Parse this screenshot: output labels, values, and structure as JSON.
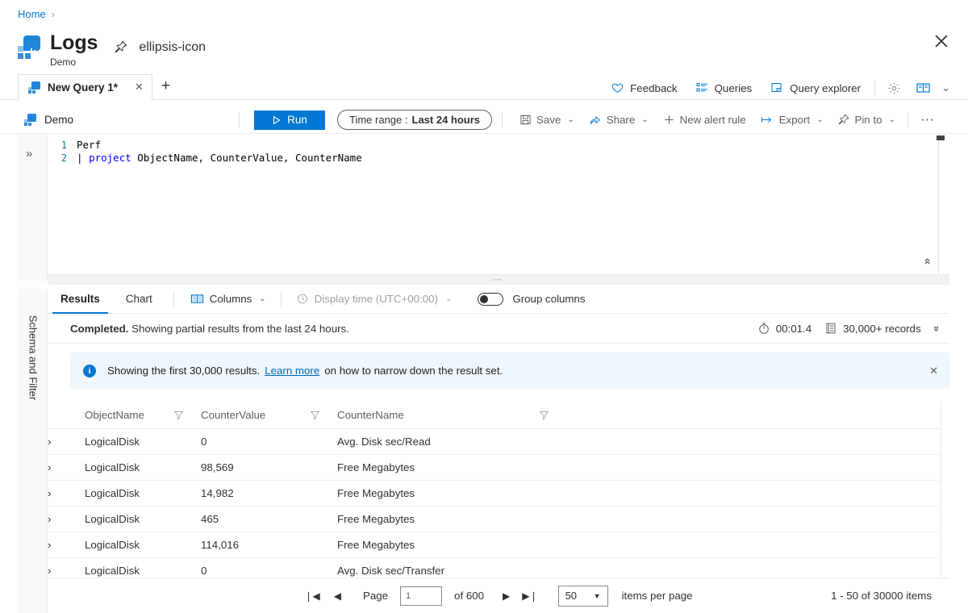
{
  "breadcrumb": {
    "home": "Home",
    "separator": "›"
  },
  "header": {
    "title": "Logs",
    "subtitle": "Demo",
    "pin_icon": "pin-icon",
    "more_icon": "ellipsis-icon",
    "close_icon": "close-icon"
  },
  "tabs": {
    "query_tab_label": "New Query 1*",
    "close_label": "✕",
    "add_label": "+"
  },
  "top_toolbar": {
    "feedback": "Feedback",
    "queries": "Queries",
    "query_explorer": "Query explorer",
    "settings_icon": "gear-icon",
    "guide_icon": "book-icon",
    "guide_chevron": "⌄"
  },
  "command_bar": {
    "workspace": "Demo",
    "run": "Run",
    "time_range_label": "Time range :",
    "time_range_value": "Last 24 hours",
    "save": "Save",
    "share": "Share",
    "new_alert_rule": "New alert rule",
    "export": "Export",
    "pin_to": "Pin to",
    "more": "⋯",
    "chevron": "⌄"
  },
  "rail": {
    "expand_icon": "»",
    "label": "Schema and Filter"
  },
  "editor": {
    "lines": [
      "1",
      "2"
    ],
    "line1": "Perf",
    "line2_pipe": "| ",
    "line2_keyword": "project",
    "line2_rest": " ObjectName, CounterValue, CounterName",
    "collapse_icon": "«"
  },
  "results": {
    "tab_results": "Results",
    "tab_chart": "Chart",
    "columns": "Columns",
    "display_time": "Display time (UTC+00:00)",
    "group_columns": "Group columns",
    "status_bold": "Completed.",
    "status_rest": " Showing partial results from the last 24 hours.",
    "duration": "00:01.4",
    "record_count": "30,000+ records",
    "expand_icon": "»"
  },
  "banner": {
    "text_before": "Showing the first 30,000 results.",
    "link": "Learn more",
    "text_after": "on how to narrow down the result set.",
    "close": "✕"
  },
  "table": {
    "columns": [
      "ObjectName",
      "CounterValue",
      "CounterName"
    ],
    "rows": [
      {
        "expand": "›",
        "ObjectName": "LogicalDisk",
        "CounterValue": "0",
        "CounterName": "Avg. Disk sec/Read"
      },
      {
        "expand": "›",
        "ObjectName": "LogicalDisk",
        "CounterValue": "98,569",
        "CounterName": "Free Megabytes"
      },
      {
        "expand": "›",
        "ObjectName": "LogicalDisk",
        "CounterValue": "14,982",
        "CounterName": "Free Megabytes"
      },
      {
        "expand": "›",
        "ObjectName": "LogicalDisk",
        "CounterValue": "465",
        "CounterName": "Free Megabytes"
      },
      {
        "expand": "›",
        "ObjectName": "LogicalDisk",
        "CounterValue": "114,016",
        "CounterName": "Free Megabytes"
      },
      {
        "expand": "›",
        "ObjectName": "LogicalDisk",
        "CounterValue": "0",
        "CounterName": "Avg. Disk sec/Transfer"
      }
    ]
  },
  "pager": {
    "first": "❘◀",
    "prev": "◀",
    "page_label": "Page",
    "page_value": "1",
    "of_label": "of 600",
    "next": "▶",
    "last": "▶❘",
    "page_size": "50",
    "items_per_page": "items per page",
    "range_text": "1 - 50 of 30000 items"
  },
  "colors": {
    "accent": "#0078d4",
    "banner_bg": "#eff6fc",
    "keyword": "#0000ff",
    "line_number": "#237893"
  }
}
